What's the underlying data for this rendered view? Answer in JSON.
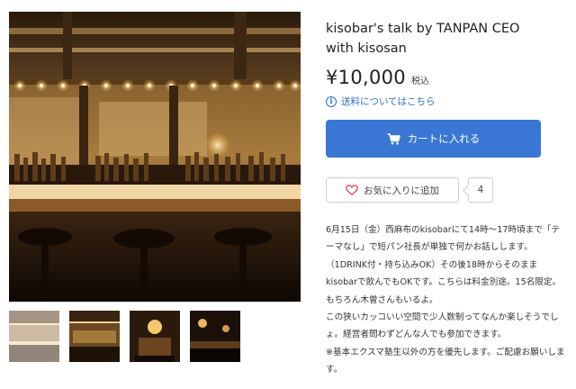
{
  "product": {
    "title": "kisobar's talk by TANPAN CEO with kisosan",
    "price": "¥10,000",
    "tax_label": "税込",
    "shipping_link": "送料についてはこちら",
    "cart_button": "カートに入れる",
    "favorite_button": "お気に入りに追加",
    "favorite_count": "4",
    "description": [
      "6月15日（金）西麻布のkisobarにて14時〜17時頃まで「テーマなし」で短パン社長が単独で何かお話しします。（1DRINK付・持ち込みOK）その後18時からそのままkisobarで飲んでもOKです。こちらは料金別途。15名限定。もちろん木曽さんもいるよ。",
      "この狭いカッコいい空間で少人数制ってなんか楽しそうでしょ。経営者問わずどんな人でも参加できます。",
      "※基本エクスマ塾生以外の方を優先します。ご配慮お願いします。"
    ]
  },
  "gallery": {
    "thumbnail_count": 4,
    "active_index": 0
  },
  "icons": {
    "info": "info-circle-icon",
    "cart": "shopping-cart-icon",
    "heart": "heart-outline-icon"
  },
  "colors": {
    "accent": "#3a77d4",
    "link": "#2a6fd6",
    "heart": "#e0455a"
  }
}
